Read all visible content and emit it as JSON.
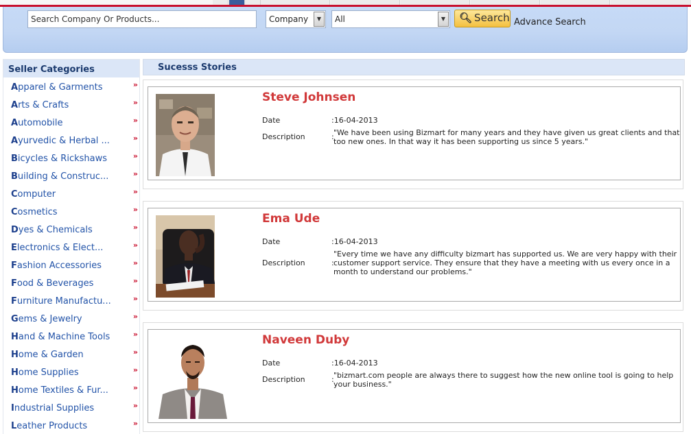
{
  "search": {
    "placeholder": "Search Company Or Products...",
    "type_select": "Company",
    "category_select": "All",
    "button_label": "Search",
    "advance_label": "Advance Search"
  },
  "sidebar": {
    "title": "Seller Categories",
    "items": [
      {
        "first": "A",
        "rest": "pparel & Garments"
      },
      {
        "first": "A",
        "rest": "rts & Crafts"
      },
      {
        "first": "A",
        "rest": "utomobile"
      },
      {
        "first": "A",
        "rest": "yurvedic & Herbal ..."
      },
      {
        "first": "B",
        "rest": "icycles & Rickshaws"
      },
      {
        "first": "B",
        "rest": "uilding & Construc..."
      },
      {
        "first": "C",
        "rest": "omputer"
      },
      {
        "first": "C",
        "rest": "osmetics"
      },
      {
        "first": "D",
        "rest": "yes & Chemicals"
      },
      {
        "first": "E",
        "rest": "lectronics & Elect..."
      },
      {
        "first": "F",
        "rest": "ashion Accessories"
      },
      {
        "first": "F",
        "rest": "ood & Beverages"
      },
      {
        "first": "F",
        "rest": "urniture Manufactu..."
      },
      {
        "first": "G",
        "rest": "ems & Jewelry"
      },
      {
        "first": "H",
        "rest": "and & Machine Tools"
      },
      {
        "first": "H",
        "rest": "ome & Garden"
      },
      {
        "first": "H",
        "rest": "ome Supplies"
      },
      {
        "first": "H",
        "rest": "ome Textiles & Fur..."
      },
      {
        "first": "I",
        "rest": "ndustrial Supplies"
      },
      {
        "first": "L",
        "rest": "eather Products"
      }
    ],
    "arrow_glyph": "»"
  },
  "main": {
    "title": "Sucesss Stories",
    "date_label": "Date",
    "desc_label": "Description",
    "stories": [
      {
        "name": "Steve Johnsen",
        "date": ":16-04-2013",
        "description": "\"We have been using Bizmart for many years and they have given us great clients and that too new ones. In that way it has been supporting us since 5 years.\""
      },
      {
        "name": "Ema Ude",
        "date": ":16-04-2013",
        "description": "\"Every time we have any difficulty bizmart has supported us. We are very happy with their customer support service. They ensure that they have a meeting with us every once in a month to understand our problems.\""
      },
      {
        "name": "Naveen Duby",
        "date": ":16-04-2013",
        "description": "\"bizmart.com people are always there to suggest how the new online tool is going to help your business.\""
      }
    ]
  },
  "colors": {
    "accent_red": "#c8102e",
    "name_red": "#d1393a",
    "link_blue": "#2253a8"
  }
}
